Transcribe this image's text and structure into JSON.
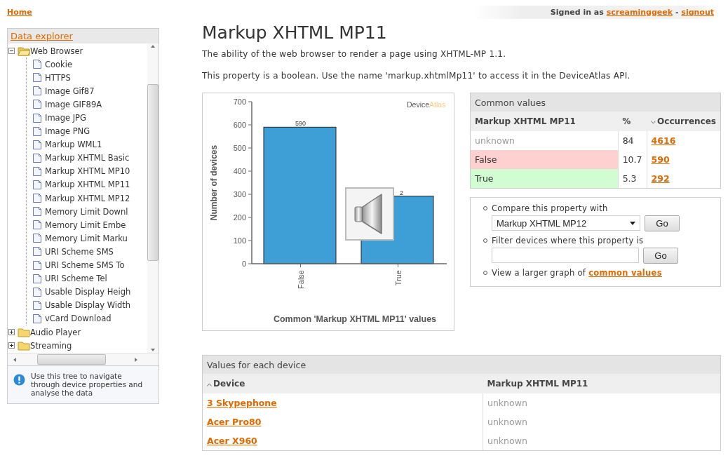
{
  "top_bar": {
    "home_link": "Home",
    "signed_in": {
      "prefix": "Signed in as",
      "user": "screaminggeek",
      "separator": "-",
      "signout": "signout"
    }
  },
  "sidebar": {
    "title": "Data explorer",
    "tree": [
      {
        "label": "Web Browser",
        "expanded": true,
        "children": [
          {
            "label": "Cookie"
          },
          {
            "label": "HTTPS"
          },
          {
            "label": "Image Gif87"
          },
          {
            "label": "Image GIF89A"
          },
          {
            "label": "Image JPG"
          },
          {
            "label": "Image PNG"
          },
          {
            "label": "Markup WML1"
          },
          {
            "label": "Markup XHTML Basic"
          },
          {
            "label": "Markup XHTML MP10"
          },
          {
            "label": "Markup XHTML MP11"
          },
          {
            "label": "Markup XHTML MP12"
          },
          {
            "label": "Memory Limit Downl"
          },
          {
            "label": "Memory Limit Embe"
          },
          {
            "label": "Memory Limit Marku"
          },
          {
            "label": "URI Scheme SMS"
          },
          {
            "label": "URI Scheme SMS To"
          },
          {
            "label": "URI Scheme Tel"
          },
          {
            "label": "Usable Display Heigh"
          },
          {
            "label": "Usable Display Width"
          },
          {
            "label": "vCard Download"
          }
        ]
      },
      {
        "label": "Audio Player",
        "expanded": false
      },
      {
        "label": "Streaming",
        "expanded": false
      }
    ],
    "info": "Use this tree to navigate through device properties and analyse the data"
  },
  "page": {
    "title": "Markup XHTML MP11",
    "description": "The ability of the web browser to render a page using XHTML-MP 1.1.",
    "note": "This property is a boolean. Use the name 'markup.xhtmlMp11' to access it in the DeviceAtlas API."
  },
  "chart_panel": {
    "logo": {
      "main": "Device",
      "suffix": "Atlas"
    },
    "chart_data": {
      "type": "bar",
      "title": "Common 'Markup XHTML MP11' values",
      "ylabel": "Number of devices",
      "categories": [
        "False",
        "True"
      ],
      "series": [
        {
          "color": "#3d9fd6",
          "values": [
            590,
            292
          ]
        }
      ],
      "ylim": [
        0,
        700
      ],
      "yticks": [
        0,
        100,
        200,
        300,
        400,
        500,
        600,
        700
      ],
      "value_labels": [
        "590",
        "2"
      ]
    }
  },
  "common_values": {
    "title": "Common values",
    "columns": [
      {
        "label": "Markup XHTML MP11",
        "sorted": false
      },
      {
        "label": "%",
        "sorted": false
      },
      {
        "label": "Occurrences",
        "sorted": true,
        "descending": true
      }
    ],
    "rows": [
      {
        "value": "unknown",
        "kind": "unknown",
        "color": "#ffffff",
        "percent": "84",
        "occurrences": "4616"
      },
      {
        "value": "False",
        "kind": "value",
        "color": "#ffd0d0",
        "percent": "10.7",
        "occurrences": "590"
      },
      {
        "value": "True",
        "kind": "value",
        "color": "#d2fcd2",
        "percent": "5.3",
        "occurrences": "292"
      }
    ]
  },
  "options": [
    {
      "kind": "compare",
      "label": "Compare this property with",
      "select_value": "Markup XHTML MP12",
      "button": "Go"
    },
    {
      "kind": "filter",
      "label": "Filter devices where this property is",
      "button": "Go"
    },
    {
      "kind": "link",
      "label": "View a larger graph of",
      "link": "common values"
    }
  ],
  "devices": {
    "title": "Values for each device",
    "columns": [
      {
        "label": "Device",
        "sorted": true,
        "descending": false
      },
      {
        "label": "Markup XHTML MP11",
        "sorted": false
      }
    ],
    "rows": [
      {
        "device": "3 Skypephone",
        "value": "unknown"
      },
      {
        "device": "Acer Pro80",
        "value": "unknown"
      },
      {
        "device": "Acer X960",
        "value": "unknown"
      }
    ]
  }
}
